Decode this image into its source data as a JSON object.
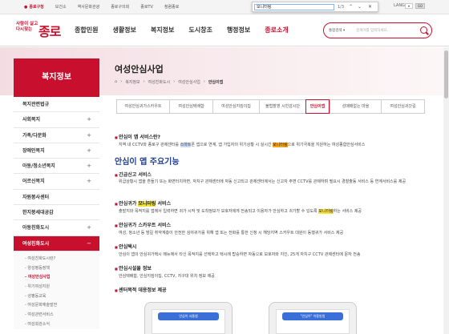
{
  "topbar": {
    "links": [
      "종로구청",
      "보건소",
      "역사문화관광",
      "종로구의회",
      "종로TV",
      "청렴종로"
    ],
    "lang": "LANG",
    "go": "GO"
  },
  "findbar": {
    "query": "모니터링",
    "count": "1/3"
  },
  "header": {
    "logo_small": "사람이 살고\n다시찾는",
    "logo_big": "종로",
    "gnb": [
      "종합민원",
      "생활정보",
      "복지정보",
      "도시창조",
      "행정정보",
      "종로소개"
    ],
    "search_select": "통합검색",
    "search_placeholder": "검색어를 입력하세요."
  },
  "hero": {
    "side_title": "복지정보"
  },
  "sidebar": {
    "items": [
      {
        "label": "복지관련법규",
        "plus": false
      },
      {
        "label": "사회복지",
        "plus": true
      },
      {
        "label": "가족/다문화",
        "plus": true
      },
      {
        "label": "장애인복지",
        "plus": true
      },
      {
        "label": "아동/청소년복지",
        "plus": true
      },
      {
        "label": "어르신복지",
        "plus": true
      },
      {
        "label": "자원봉사센터",
        "plus": false
      },
      {
        "label": "한지붕세대공감",
        "plus": false
      },
      {
        "label": "아동친화도시",
        "plus": true
      },
      {
        "label": "여성친화도시",
        "plus": true,
        "active": true,
        "sign": "−"
      }
    ],
    "sub": [
      "여성친화도시란?",
      "양성평등정책",
      "여성안심사업",
      "위기여성지원",
      "성평등교육",
      "여성문화예술발전",
      "여성관련서비스",
      "여성회관소식"
    ],
    "current_sub": 2
  },
  "main": {
    "title": "여성안심사업",
    "breadcrumb": [
      "⌂",
      "복지정보",
      "여성친화도시",
      "여성안심사업",
      "안심이앱"
    ],
    "tabs": [
      "여성안심귀가스카우트",
      "여성안심택배함",
      "여성안심지킴이집",
      "불법촬영 시민감시단",
      "안심이앱",
      "성매매없는 마을",
      "여성안심귀갓길"
    ],
    "active_tab": 4
  },
  "content": {
    "q_title": "안심이 앱 서비스란?",
    "q_body_1": "지역 내 CCTV와 종로구 관제센터를 ",
    "q_body_smart": "스마트",
    "q_body_2": "폰 앱으로 연계, 앱 가입자의 위기상황 시 실시간 ",
    "q_body_mon": "모니터링",
    "q_body_3": "으로 위기극복을 지원하는 여성종합안심서비스",
    "main_heading": "안심이 앱 주요기능",
    "s1_title": "긴급신고 서비스",
    "s1_body": "위급상황시 앱을 흔들기 또는 화면터치하면, 자치구 관제센터에 자동 신고되고 관제센터에서는 신고자 주변 CCTV를 관제하며 필요시 경찰출동 서비스 등 연계서비스를 제공",
    "s2_title_1": "안심귀가 ",
    "s2_title_mon": "모니터링",
    "s2_title_2": " 서비스",
    "s2_body_1": "출발지와 목적지를 앱에서 입력하면 귀가 시작 및 도착정보가 보호자에게 전송되고 이용자가 안심하고 귀가할 수 있도록 ",
    "s2_body_mon": "모니터링",
    "s2_body_2": "하는 서비스 제공",
    "s3_title": "안심귀가 스카우트 서비스",
    "s3_body": "여성, 청소년 등 밤길 취약계층이 안전한 심야귀가를 위해 앱 또는 전화를 통한 신청 시 해당지역 스카우트 대원이 동행귀가 서비스 제공",
    "s4_title": "안심택시",
    "s4_body": "안심이 앱의 안심귀가택시 메뉴에서 타신 목적지를 선택하고 택시에 탑승하면 자동으로 보호자와 지인, 25개 자치구 CCTV 관제센터에 문자 전송",
    "s5_title": "안심시설물 정보",
    "s5_body": "안심택배함, 안심지킴이집, CCTV, 지구대 위치 정보 제공",
    "s6_title": "센터목적 데응정보 제공",
    "phone_labels": [
      "안심이 서울앱",
      "\"안심이\" 이용방법"
    ]
  }
}
